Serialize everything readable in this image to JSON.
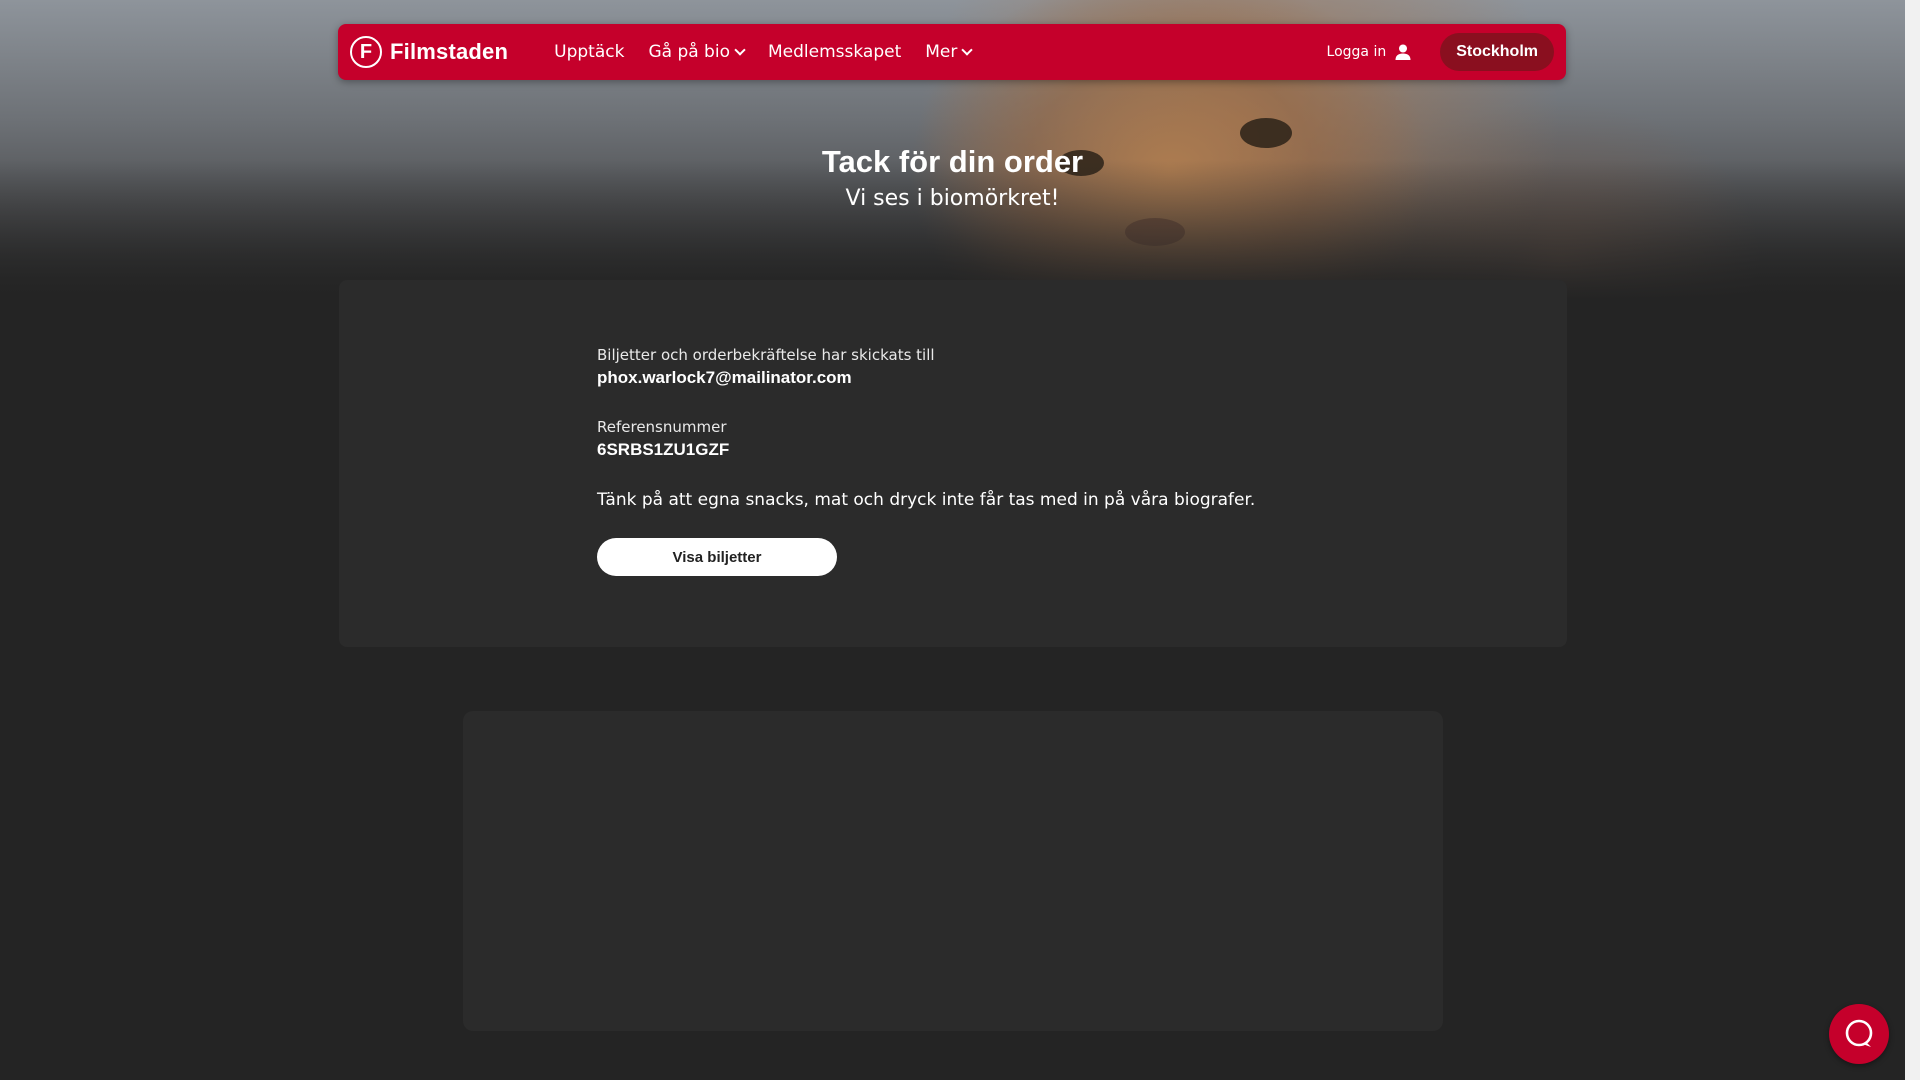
{
  "nav": {
    "brand_letter": "F",
    "brand_name": "Filmstaden",
    "links": [
      {
        "label": "Upptäck"
      },
      {
        "label": "Gå på bio"
      },
      {
        "label": "Medlemsskapet"
      },
      {
        "label": "Mer"
      }
    ],
    "login_label": "Logga in",
    "city_label": "Stockholm"
  },
  "hero": {
    "title": "Tack för din order",
    "subtitle": "Vi ses i biomörkret!"
  },
  "confirmation": {
    "sent_label": "Biljetter och orderbekräftelse har skickats till",
    "email": "phox.warlock7@mailinator.com",
    "reference_label": "Referensnummer",
    "reference": "6SRBS1ZU1GZF",
    "notice": "Tänk på att egna snacks, mat och dryck inte får tas med in på våra biografer.",
    "button_label": "Visa biljetter"
  },
  "colors": {
    "brand": "#c5002b",
    "city_button": "#8a0f1f",
    "card": "#2b2b2b",
    "background": "#242424"
  },
  "icons": {
    "user": "user-icon",
    "chat": "chat-icon",
    "chevron": "chevron-down-icon"
  }
}
